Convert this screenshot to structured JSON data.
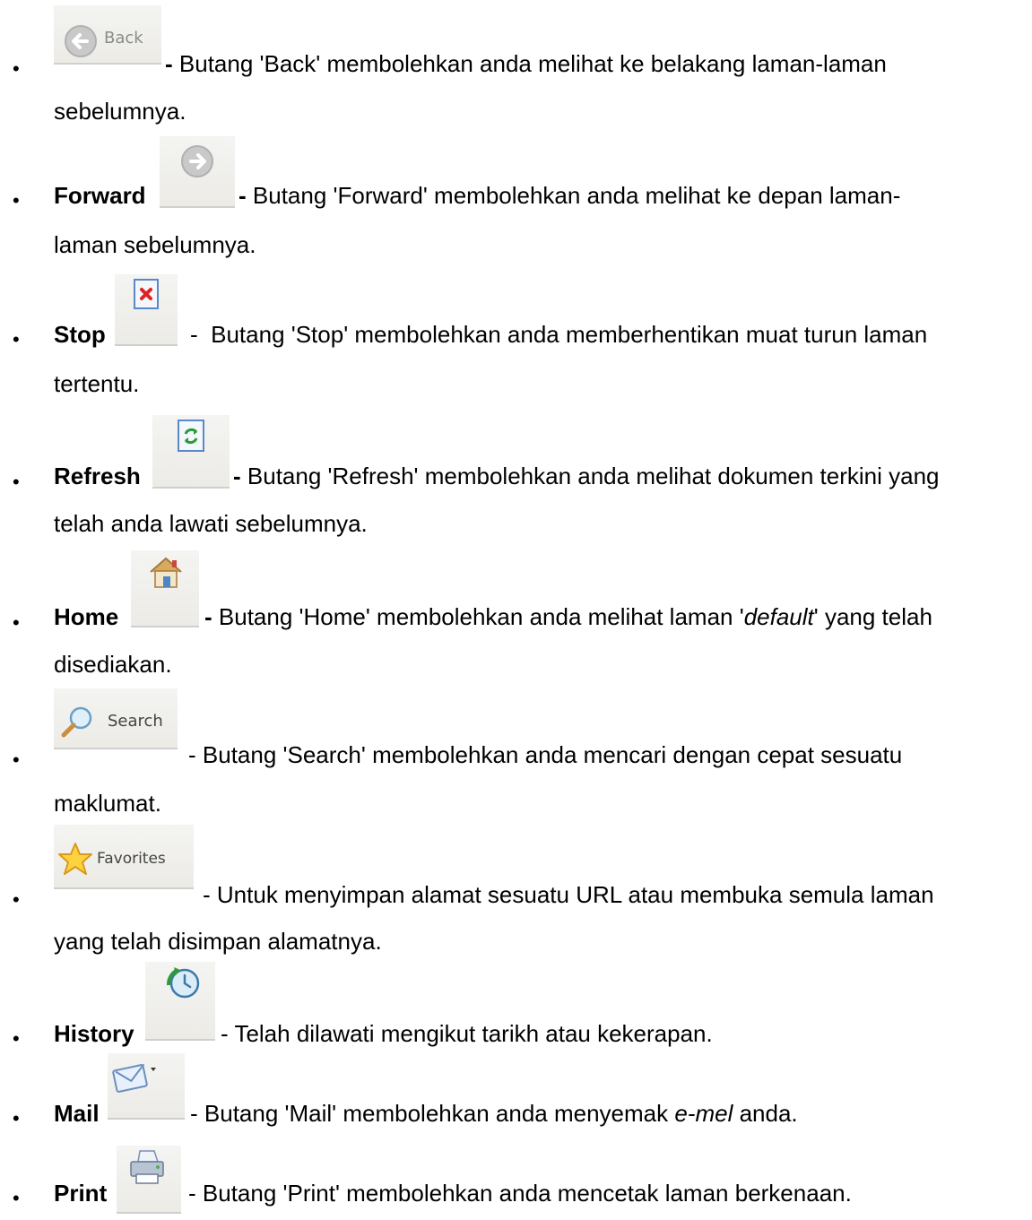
{
  "items": [
    {
      "name": "Back",
      "button_label": "Back",
      "icon": "back-arrow-icon",
      "desc1": "Butang 'Back' membolehkan anda melihat ke belakang laman-laman",
      "desc2": "sebelumnya."
    },
    {
      "name": "Forward",
      "icon": "forward-arrow-icon",
      "desc1": "Butang 'Forward' membolehkan anda melihat ke depan laman-",
      "desc2": "laman sebelumnya."
    },
    {
      "name": "Stop",
      "icon": "stop-icon",
      "desc1": "Butang 'Stop' membolehkan anda memberhentikan muat turun laman",
      "desc2": "tertentu."
    },
    {
      "name": "Refresh",
      "icon": "refresh-icon",
      "desc1": "Butang 'Refresh' membolehkan anda melihat dokumen terkini yang",
      "desc2": "telah anda lawati sebelumnya."
    },
    {
      "name": "Home",
      "icon": "home-icon",
      "desc1_pre": "Butang 'Home' membolehkan anda melihat laman '",
      "desc1_em": "default",
      "desc1_post": "' yang telah",
      "desc2": "disediakan."
    },
    {
      "name": "Search",
      "button_label": "Search",
      "icon": "search-icon",
      "desc1": "Butang 'Search' membolehkan anda mencari dengan cepat sesuatu",
      "desc2": "maklumat."
    },
    {
      "name": "Favorites",
      "button_label": "Favorites",
      "icon": "star-icon",
      "desc1": "Untuk menyimpan alamat sesuatu URL atau membuka semula laman",
      "desc2": "yang telah disimpan alamatnya."
    },
    {
      "name": "History",
      "icon": "history-icon",
      "desc1": "Telah dilawati mengikut tarikh atau kekerapan."
    },
    {
      "name": "Mail",
      "icon": "mail-icon",
      "desc1_pre": "Butang 'Mail' membolehkan anda menyemak ",
      "desc1_em": "e-mel",
      "desc1_post": " anda."
    },
    {
      "name": "Print",
      "icon": "printer-icon",
      "desc1": "Butang 'Print' membolehkan anda mencetak laman berkenaan."
    }
  ],
  "bullet_char": "•",
  "dash": "-"
}
